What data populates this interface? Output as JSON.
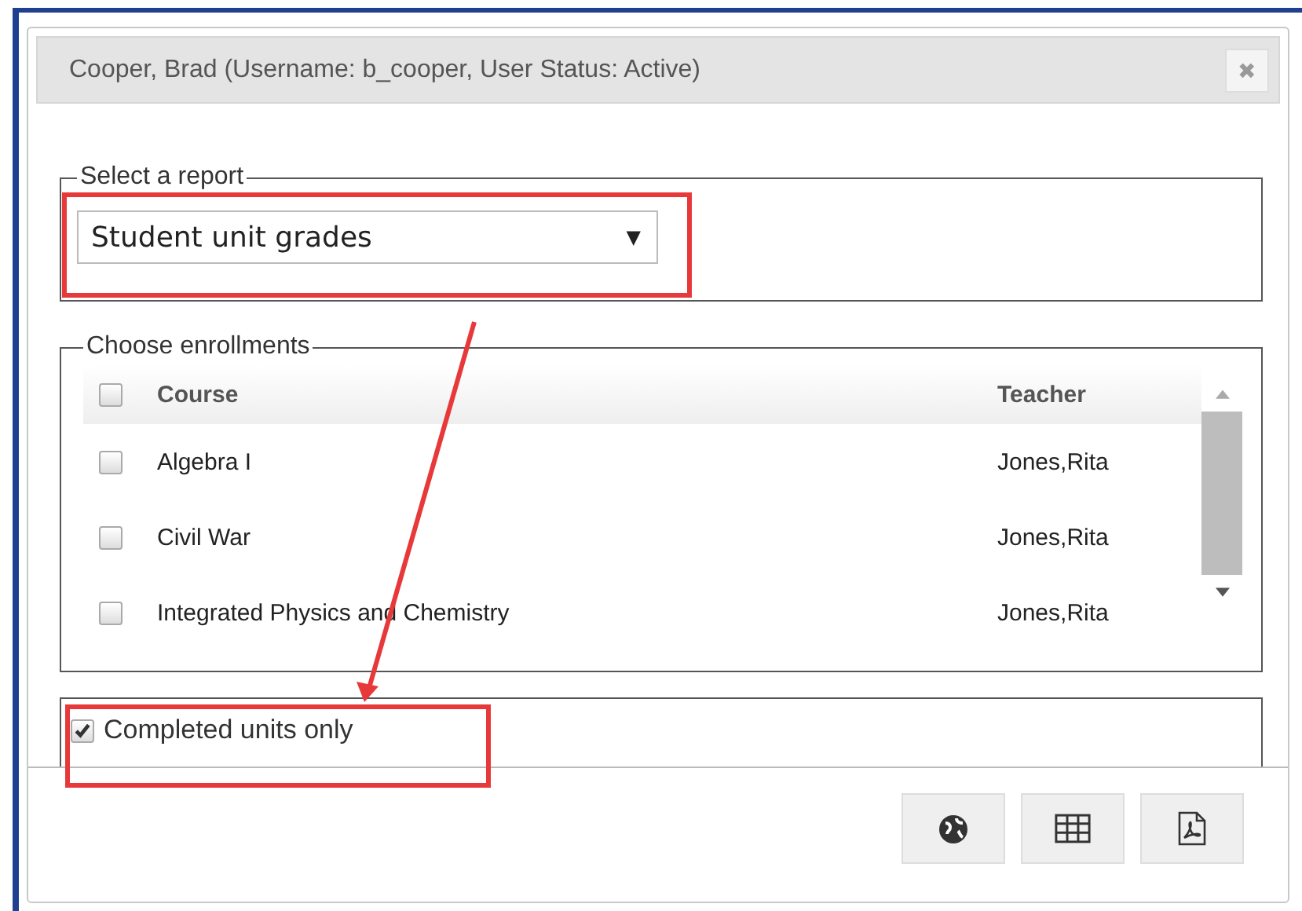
{
  "dialog": {
    "title": "Cooper, Brad (Username: b_cooper, User Status: Active)",
    "close": "✖"
  },
  "report": {
    "legend": "Select a report",
    "value": "Student unit grades",
    "caret": "▼"
  },
  "enrollments": {
    "legend": "Choose enrollments",
    "select_all": {
      "checked": false
    },
    "columns": [
      "Course",
      "Teacher"
    ],
    "rows": [
      {
        "course": "Algebra I",
        "teacher": "Jones,Rita",
        "checked": false
      },
      {
        "course": "Civil War",
        "teacher": "Jones,Rita",
        "checked": false
      },
      {
        "course": "Integrated Physics and Chemistry",
        "teacher": "Jones,Rita",
        "checked": false
      }
    ]
  },
  "options": {
    "label": "Completed units only",
    "checked": true
  }
}
